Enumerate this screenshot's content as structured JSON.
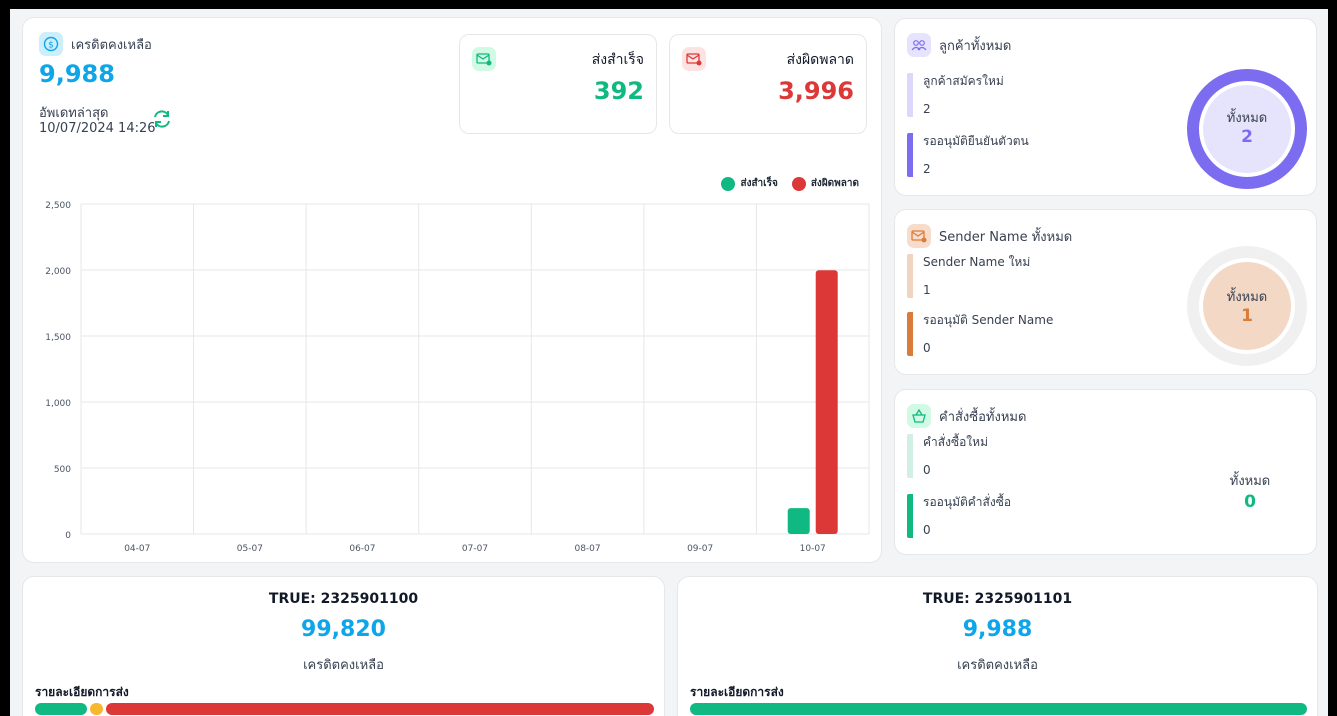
{
  "credit": {
    "label": "เครดิตคงเหลือ",
    "value": "9,988",
    "updated_label": "อัพเดทล่าสุด",
    "updated_time": "10/07/2024 14:26"
  },
  "stats": {
    "success_label": "ส่งสำเร็จ",
    "success_value": "392",
    "failed_label": "ส่งผิดพลาด",
    "failed_value": "3,996"
  },
  "colors": {
    "success": "#10b981",
    "failed": "#dc3838",
    "accent": "#0ea5e9",
    "purple": "#7c6cf0",
    "orange": "#d97c3a"
  },
  "chart_data": {
    "type": "bar",
    "categories": [
      "04-07",
      "05-07",
      "06-07",
      "07-07",
      "08-07",
      "09-07",
      "10-07"
    ],
    "series": [
      {
        "name": "ส่งสำเร็จ",
        "values": [
          0,
          0,
          0,
          0,
          0,
          0,
          196
        ]
      },
      {
        "name": "ส่งผิดพลาด",
        "values": [
          0,
          0,
          0,
          0,
          0,
          0,
          1998
        ]
      }
    ],
    "y_ticks": [
      "2,500",
      "2,000",
      "1,500",
      "1,000",
      "500",
      "0"
    ],
    "ylim": [
      0,
      2500
    ],
    "grid": true,
    "legend": "top-right"
  },
  "customers": {
    "title": "ลูกค้าทั้งหมด",
    "new_label": "ลูกค้าสมัครใหม่",
    "new_value": "2",
    "pending_label": "รออนุมัติยืนยันตัวตน",
    "pending_value": "2",
    "total_label": "ทั้งหมด",
    "total_value": "2"
  },
  "sender": {
    "title": "Sender Name ทั้งหมด",
    "new_label": "Sender Name ใหม่",
    "new_value": "1",
    "pending_label": "รออนุมัติ Sender Name",
    "pending_value": "0",
    "total_label": "ทั้งหมด",
    "total_value": "1"
  },
  "orders": {
    "title": "คำสั่งซื้อทั้งหมด",
    "new_label": "คำสั่งซื้อใหม่",
    "new_value": "0",
    "pending_label": "รออนุมัติคำสั่งซื้อ",
    "pending_value": "0",
    "total_label": "ทั้งหมด",
    "total_value": "0"
  },
  "accounts": [
    {
      "phone": "TRUE: 2325901100",
      "balance": "99,820",
      "balance_label": "เครดิตคงเหลือ",
      "detail_label": "รายละเอียดการส่ง"
    },
    {
      "phone": "TRUE: 2325901101",
      "balance": "9,988",
      "balance_label": "เครดิตคงเหลือ",
      "detail_label": "รายละเอียดการส่ง"
    }
  ]
}
